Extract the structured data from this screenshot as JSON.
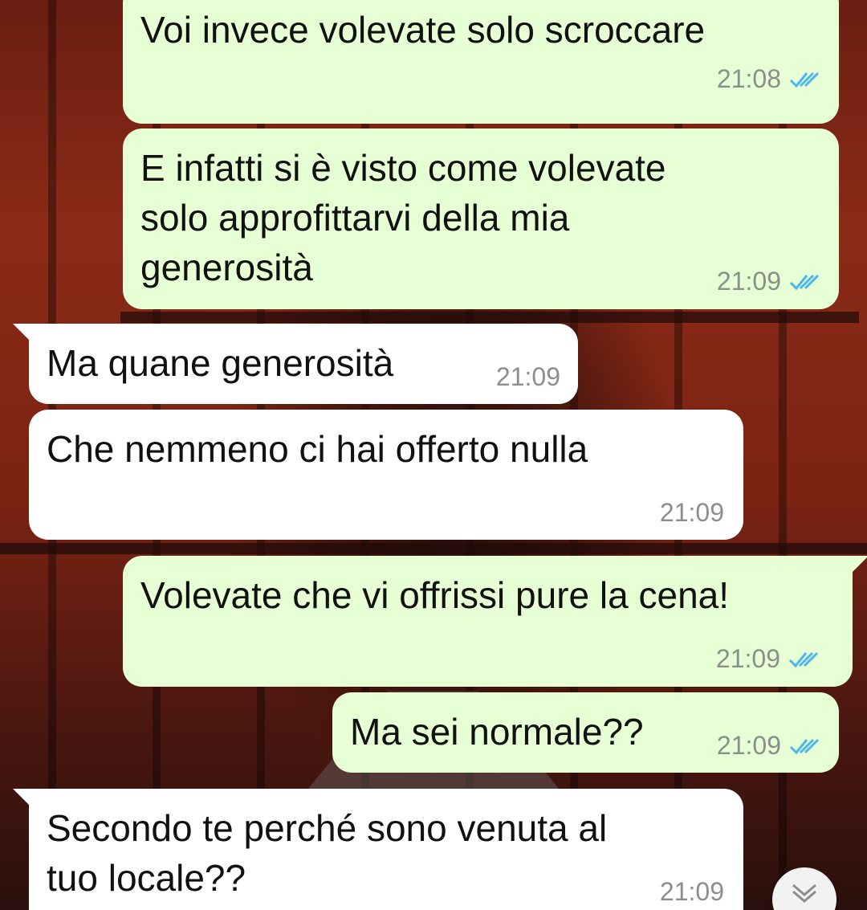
{
  "messages": [
    {
      "direction": "outgoing",
      "text": "Voi invece volevate solo scroccare",
      "time": "21:08",
      "status": "read"
    },
    {
      "direction": "outgoing",
      "text": "E infatti si è visto come volevate\nsolo approfittarvi della mia\ngenerosità",
      "time": "21:09",
      "status": "read"
    },
    {
      "direction": "incoming",
      "text": "Ma quane generosità",
      "time": "21:09"
    },
    {
      "direction": "incoming",
      "text": "Che nemmeno ci hai offerto nulla",
      "time": "21:09"
    },
    {
      "direction": "outgoing",
      "text": "Volevate che vi offrissi pure la cena!",
      "time": "21:09",
      "status": "read"
    },
    {
      "direction": "outgoing",
      "text": "Ma sei normale??",
      "time": "21:09",
      "status": "read"
    },
    {
      "direction": "incoming",
      "text": "Secondo te perché sono venuta al\ntuo locale??",
      "time": "21:09"
    }
  ],
  "colors": {
    "outgoing_bubble": "#e6ffd4",
    "incoming_bubble": "#ffffff",
    "read_ticks": "#4fb6ec",
    "time_text": "#8a8f8a"
  },
  "icons": {
    "read_receipt": "double-check-icon",
    "scroll_down": "chevron-double-down-icon"
  }
}
